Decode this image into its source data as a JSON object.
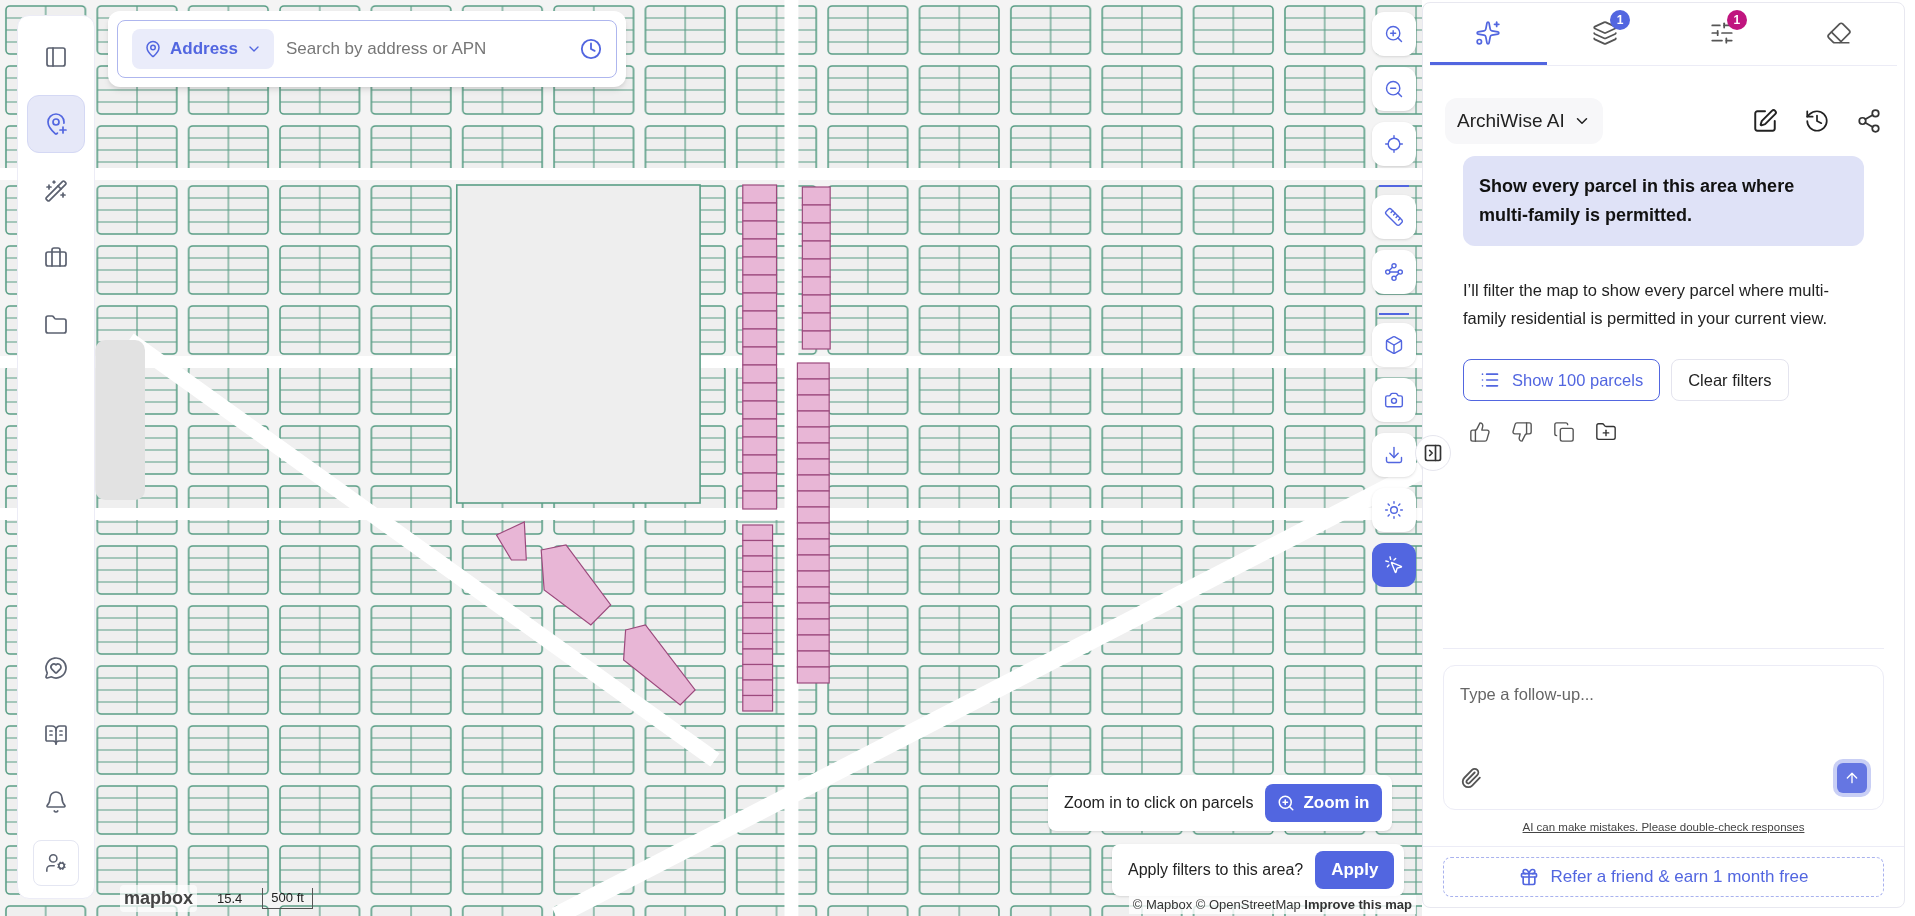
{
  "sidebar": {
    "top_items": [
      {
        "selected": false
      },
      {
        "selected": true
      },
      {
        "selected": false
      },
      {
        "selected": false
      },
      {
        "selected": false
      }
    ]
  },
  "search": {
    "mode": "Address",
    "placeholder": "Search by address or APN"
  },
  "map_tools": [
    {
      "selected": false
    },
    {
      "selected": false
    },
    {
      "selected": false
    },
    {
      "selected": false
    },
    {
      "selected": false
    },
    {
      "selected": false
    },
    {
      "selected": false
    },
    {
      "selected": false
    },
    {
      "selected": false
    },
    {
      "selected": true
    }
  ],
  "zoom_hint": {
    "text": "Zoom in to click on parcels",
    "button": "Zoom in"
  },
  "apply_prompt": {
    "text": "Apply filters to this area?",
    "button": "Apply"
  },
  "map_footer": {
    "logo": "mapbox",
    "zoom": "15.4",
    "scale": "500 ft",
    "attribution": "© Mapbox © OpenStreetMap **Improve this map**"
  },
  "panel": {
    "tabs": [
      {
        "selected": true
      },
      {
        "selected": false,
        "badge": "1",
        "color": "#5266e0"
      },
      {
        "selected": false,
        "badge": "1",
        "color": "#c0157f"
      },
      {
        "selected": false
      }
    ],
    "assistant": "ArchiWise AI",
    "messages": [
      {
        "kind": "user",
        "text": "Show every parcel in this area where multi-family is permitted."
      },
      {
        "kind": "assistant",
        "text": "I’ll filter the map to show every parcel where multi-family residential is permitted in your current view."
      }
    ],
    "actions": [
      {
        "kind": "primary",
        "label": "Show 100 parcels"
      },
      {
        "kind": "secondary",
        "label": "Clear filters"
      }
    ],
    "input": {
      "placeholder": "Type a follow-up..."
    },
    "disclaimer": "AI can make mistakes. Please double-check responses",
    "referral": "Refer a friend & earn 1 month free"
  }
}
